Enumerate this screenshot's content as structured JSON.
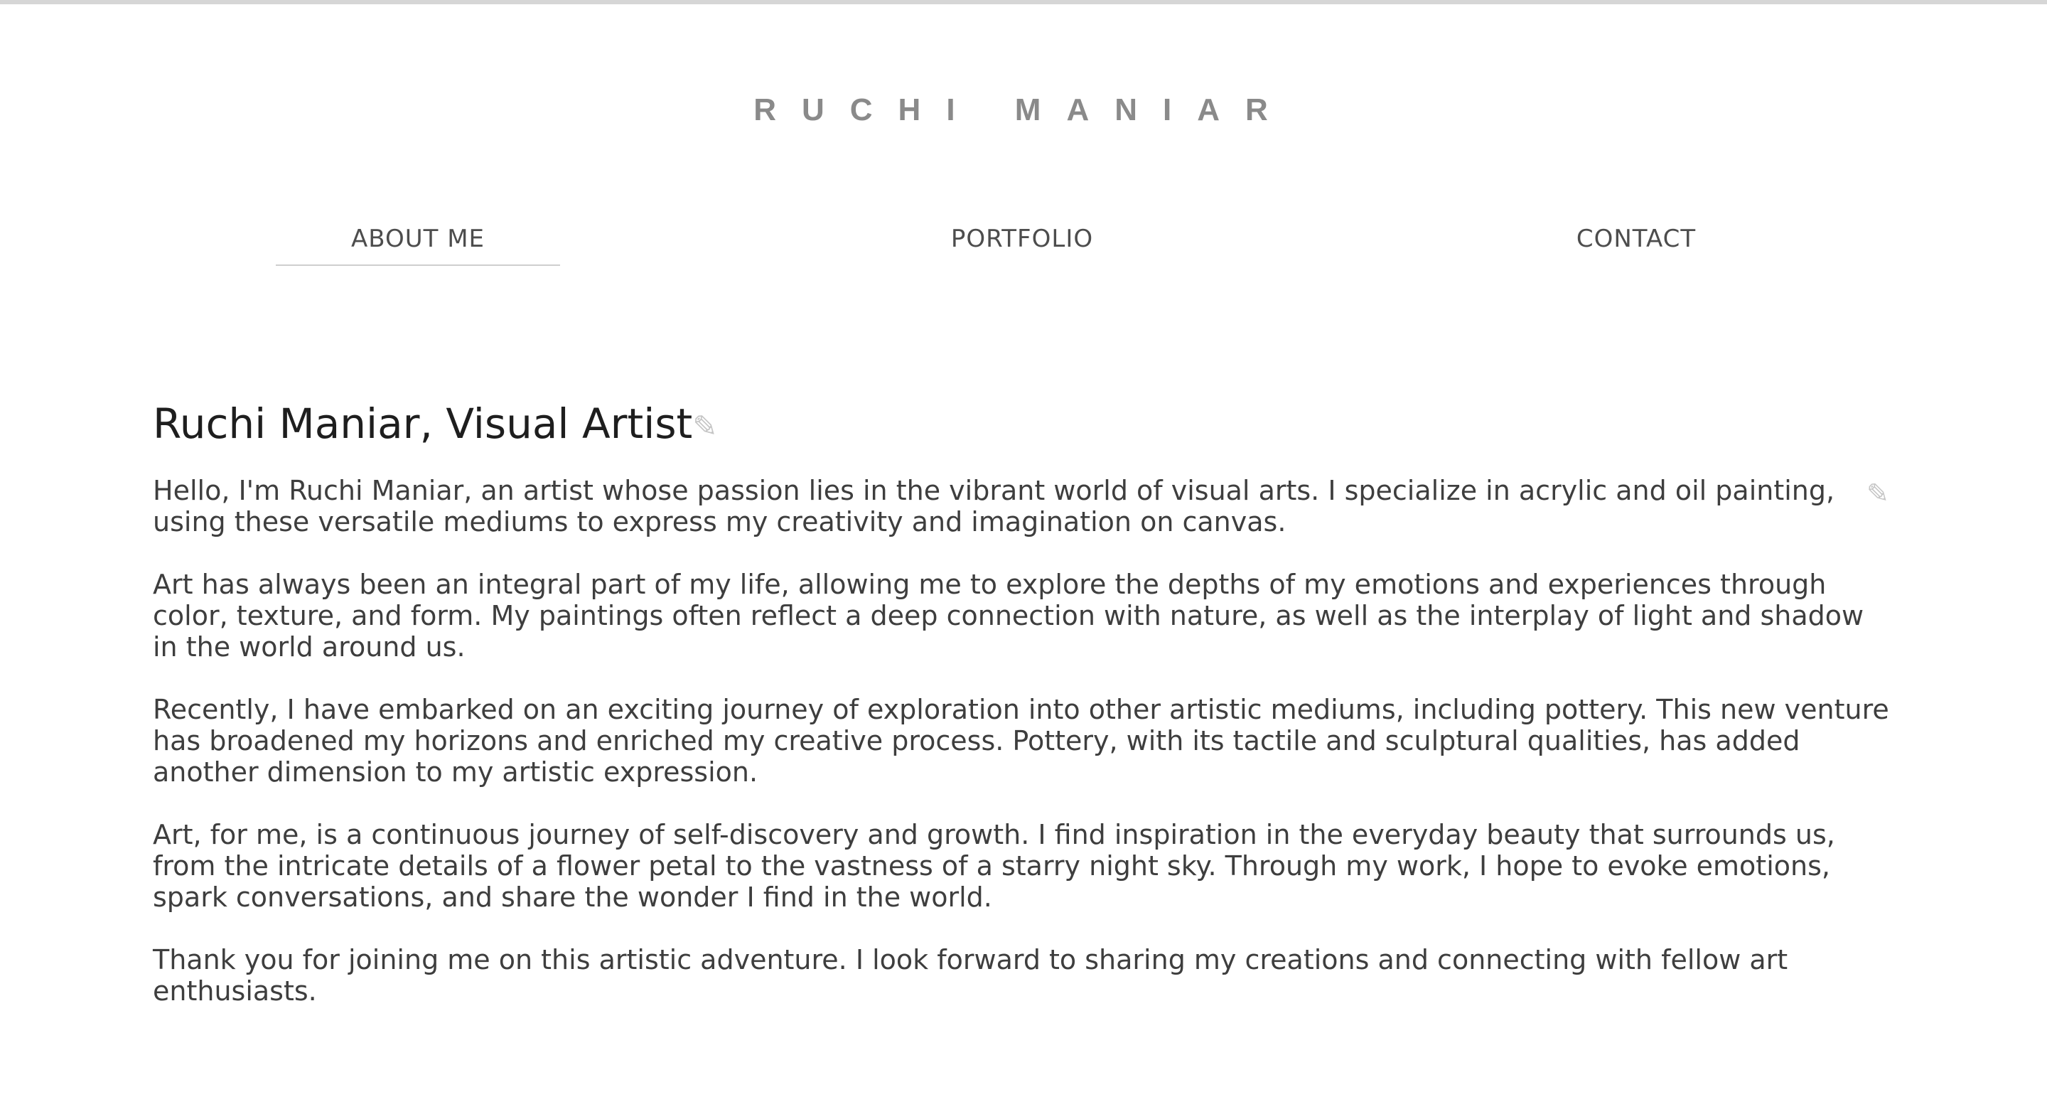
{
  "site": {
    "brand": "RUCHI MANIAR"
  },
  "nav": {
    "items": [
      {
        "label": "ABOUT ME",
        "active": true
      },
      {
        "label": "PORTFOLIO",
        "active": false
      },
      {
        "label": "CONTACT",
        "active": false
      }
    ]
  },
  "about": {
    "title": "Ruchi Maniar, Visual Artist",
    "paragraphs": [
      " Hello, I'm Ruchi Maniar, an artist whose passion lies in the vibrant world of visual arts. I specialize in acrylic and oil painting, using these versatile mediums to express my creativity and imagination on canvas.",
      "Art has always been an integral part of my life, allowing me to explore the depths of my emotions and experiences through color, texture, and form. My paintings often reflect a deep connection with nature, as well as the interplay of light and shadow in the world around us.",
      "Recently, I have embarked on an exciting journey of exploration into other artistic mediums, including pottery. This new venture has broadened my horizons and enriched my creative process. Pottery, with its tactile and sculptural qualities, has added another dimension to my artistic expression.",
      "Art, for me, is a continuous journey of self-discovery and growth. I find inspiration in the everyday beauty that surrounds us, from the intricate details of a flower petal to the vastness of a starry night sky. Through my work, I hope to evoke emotions, spark conversations, and share the wonder I find in the world.",
      "Thank you for joining me on this artistic adventure. I look forward to sharing my creations and connecting with fellow art enthusiasts."
    ]
  },
  "icons": {
    "edit": "pencil-icon"
  },
  "colors": {
    "brand_text": "#8a8a8a",
    "nav_text": "#4d4d4d",
    "title_text": "#1e1e1e",
    "body_text": "#3e3e3e",
    "active_underline": "#cfcfcf"
  }
}
